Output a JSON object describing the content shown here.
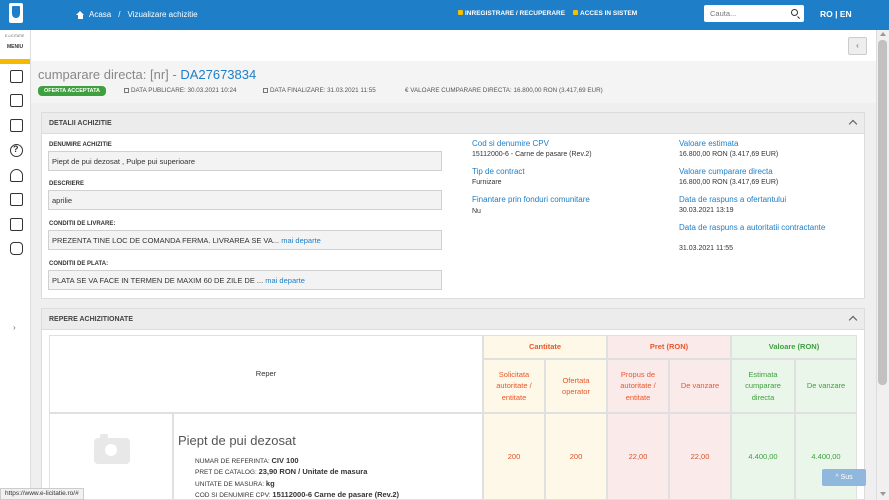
{
  "topbar": {
    "home": "Acasa",
    "breadcrumb_current": "Vizualizare achizitie",
    "register": "INREGISTRARE / RECUPERARE",
    "login": "ACCES IN SISTEM",
    "search_placeholder": "Cauta...",
    "lang": "RO | EN"
  },
  "sidebar": {
    "logo_text": "E-LICITATIE",
    "menu_label": "MENIU",
    "icons": [
      "document-icon",
      "document-arrow-icon",
      "safe-icon",
      "help-icon",
      "hand-coins-icon",
      "id-card-icon",
      "register-icon",
      "chat-icon"
    ]
  },
  "page": {
    "title_prefix": "cumparare directa: [nr] - ",
    "title_code": "DA27673834",
    "status": "OFERTA ACCEPTATA",
    "publish_date": "DATA PUBLICARE: 30.03.2021 10:24",
    "finalize_date": "DATA FINALIZARE: 31.03.2021 11:55",
    "value": "€ VALOARE CUMPARARE DIRECTA: 16.800,00  RON (3.417,69  EUR)"
  },
  "details": {
    "header": "DETALII ACHIZITIE",
    "name_label": "DENUMIRE ACHIZITIE",
    "name_value": "Piept de pui dezosat , Pulpe pui superioare",
    "desc_label": "DESCRIERE",
    "desc_value": "aprilie",
    "delivery_label": "CONDITII DE LIVRARE:",
    "delivery_value": "PREZENTA TINE LOC DE COMANDA FERMA. LIVRAREA SE VA...",
    "payment_label": "CONDITII DE PLATA:",
    "payment_value": "PLATA SE VA FACE IN TERMEN DE MAXIM 60 DE ZILE DE ...",
    "more": "mai departe",
    "cpv_label": "Cod si denumire CPV",
    "cpv_value": "15112000-6 - Carne de pasare (Rev.2)",
    "contract_label": "Tip de contract",
    "contract_value": "Furnizare",
    "funding_label": "Finantare prin fonduri comunitare",
    "funding_value": "Nu",
    "est_label": "Valoare estimata",
    "est_value": "16.800,00  RON (3.417,69  EUR)",
    "direct_label": "Valoare cumparare directa",
    "direct_value": "16.800,00  RON (3.417,69  EUR)",
    "reply_supplier_label": "Data de raspuns a ofertantului",
    "reply_supplier_value": "30.03.2021 13:19",
    "reply_authority_label": "Data de raspuns a autoritatii contractante",
    "reply_authority_value": "31.03.2021 11:55"
  },
  "items": {
    "header": "REPERE ACHIZITIONATE",
    "col_reper": "Reper",
    "grp_cantitate": "Cantitate",
    "grp_pret": "Pret (RON)",
    "grp_valoare": "Valoare (RON)",
    "sub_solicitata": "Solicitata autoritate / entitate",
    "sub_ofertata": "Ofertata operator",
    "sub_propus": "Propus de autoritate / entitate",
    "sub_de_vanzare_pret": "De vanzare",
    "sub_estimata": "Estimata cumparare directa",
    "sub_de_vanzare_val": "De vanzare",
    "product": {
      "title": "Piept de pui dezosat",
      "ref_label": "NUMAR DE REFERINTA:",
      "ref_value": "CIV 100",
      "price_label": "PRET DE CATALOG:",
      "price_value": "23,90  RON / Unitate de masura",
      "unit_label": "UNITATE DE MASURA:",
      "unit_value": "kg",
      "cpv_label": "COD SI DENUMIRE CPV:",
      "cpv_value": "15112000-6 Carne de pasare (Rev.2)",
      "solicitata": "200",
      "ofertata": "200",
      "propus": "22,00",
      "pret_vanzare": "22,00",
      "estimata": "4.400,00",
      "val_vanzare": "4.400,00"
    }
  },
  "footer": {
    "status_url": "https://www.e-licitatie.ro/#",
    "back_to_top": "Sus"
  }
}
